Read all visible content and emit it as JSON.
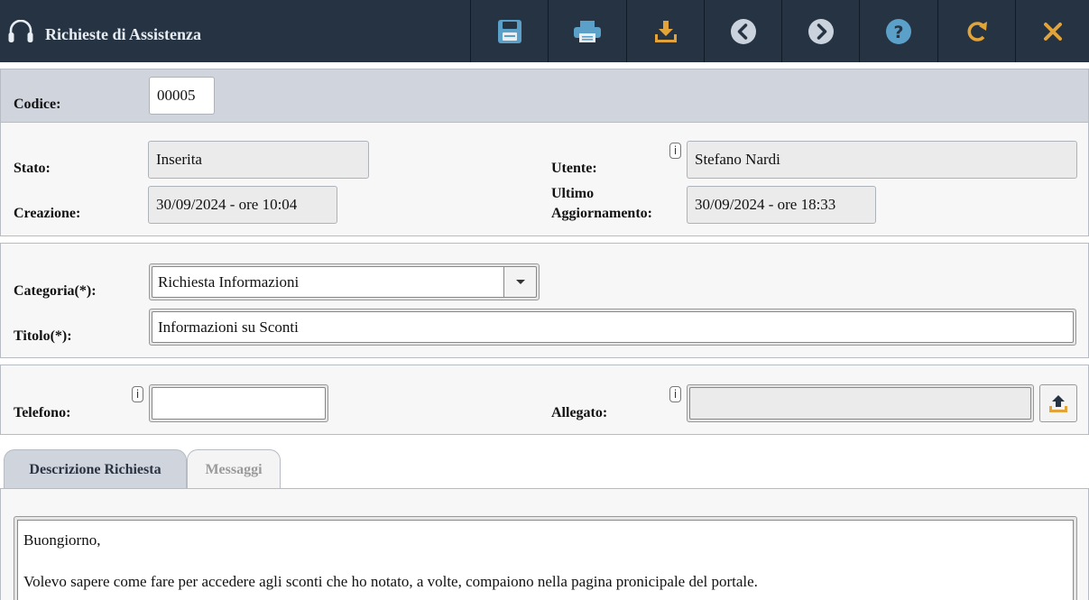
{
  "header": {
    "title": "Richieste di Assistenza",
    "app_icon": "headset-icon",
    "accent_color": "#253343",
    "toolbar": [
      {
        "name": "save-button",
        "icon": "floppy-disk-icon",
        "color": "#5aa0c8"
      },
      {
        "name": "print-button",
        "icon": "printer-icon",
        "color": "#5aa0c8"
      },
      {
        "name": "download-button",
        "icon": "download-icon",
        "color": "#e2a33a"
      },
      {
        "name": "previous-button",
        "icon": "chevron-left-icon",
        "color": "#c9d2dd"
      },
      {
        "name": "next-button",
        "icon": "chevron-right-icon",
        "color": "#c9d2dd"
      },
      {
        "name": "help-button",
        "icon": "help-icon",
        "color": "#5aa0c8"
      },
      {
        "name": "refresh-button",
        "icon": "refresh-icon",
        "color": "#e2a33a"
      },
      {
        "name": "close-button",
        "icon": "close-icon",
        "color": "#e2a33a"
      }
    ]
  },
  "codice": {
    "label": "Codice:",
    "value": "00005"
  },
  "info": {
    "stato_label": "Stato:",
    "stato_value": "Inserita",
    "creazione_label": "Creazione:",
    "creazione_value": "30/09/2024 - ore 10:04",
    "utente_label": "Utente:",
    "utente_value": "Stefano Nardi",
    "ultimo_label_1": "Ultimo",
    "ultimo_label_2": "Aggiornamento:",
    "ultimo_value": "30/09/2024 - ore 18:33",
    "info_badge": "i"
  },
  "form": {
    "categoria_label": "Categoria(*):",
    "categoria_value": "Richiesta Informazioni",
    "titolo_label": "Titolo(*):",
    "titolo_value": "Informazioni su Sconti"
  },
  "contact": {
    "telefono_label": "Telefono:",
    "telefono_value": "",
    "allegato_label": "Allegato:",
    "allegato_value": ""
  },
  "tabs": [
    {
      "label": "Descrizione Richiesta",
      "active": true
    },
    {
      "label": "Messaggi",
      "active": false
    }
  ],
  "description": {
    "line1": "Buongiorno,",
    "line2": "Volevo sapere come fare per accedere agli sconti che ho notato, a volte, compaiono nella pagina pronicipale del portale."
  }
}
